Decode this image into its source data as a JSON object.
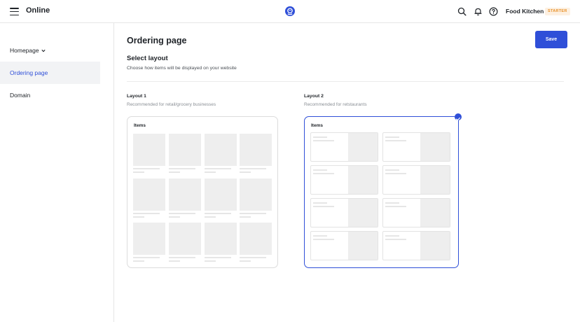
{
  "topbar": {
    "app_title": "Online",
    "store_name": "Food Kitchen",
    "plan_badge": "STARTER",
    "icons": [
      "menu-icon",
      "brand-logo-icon",
      "search-icon",
      "bell-icon",
      "help-icon"
    ]
  },
  "sidebar": {
    "items": [
      {
        "label": "Homepage",
        "has_dropdown": true,
        "active": false
      },
      {
        "label": "Ordering page",
        "has_dropdown": false,
        "active": true
      },
      {
        "label": "Domain",
        "has_dropdown": false,
        "active": false
      }
    ]
  },
  "main": {
    "page_title": "Ordering page",
    "save_label": "Save",
    "section_title": "Select layout",
    "section_subtitle": "Choose how items will be displayed on your website",
    "layouts": [
      {
        "label": "Layout 1",
        "description": "Recommended for retail/grocery businesses",
        "card_title": "Items",
        "selected": false,
        "style": "grid"
      },
      {
        "label": "Layout 2",
        "description": "Recommended for retstaurants",
        "card_title": "Items",
        "selected": true,
        "style": "list"
      }
    ]
  },
  "colors": {
    "accent": "#2f4fd8",
    "badge_text": "#e8912a",
    "badge_bg": "#fdf0e1",
    "active_bg": "#f2f3f5"
  }
}
